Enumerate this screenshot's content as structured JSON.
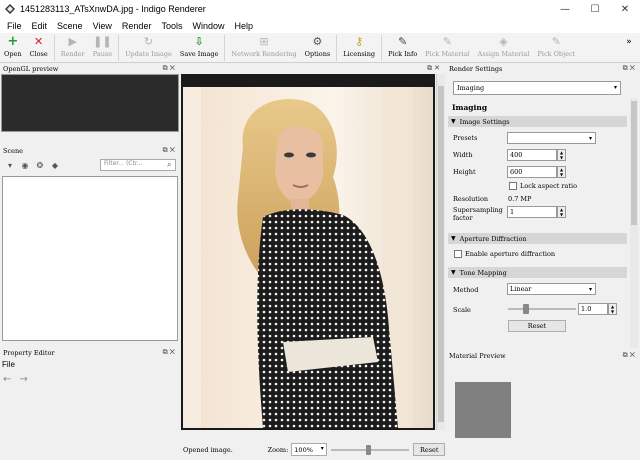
{
  "window": {
    "title": "1451283113_ATsXnwDA.jpg - Indigo Renderer"
  },
  "menu": [
    "File",
    "Edit",
    "Scene",
    "View",
    "Render",
    "Tools",
    "Window",
    "Help"
  ],
  "toolbar": {
    "open": "Open",
    "close": "Close",
    "render": "Render",
    "pause": "Pause",
    "update_image": "Update Image",
    "save_image": "Save Image",
    "network_rendering": "Network Rendering",
    "options": "Options",
    "licensing": "Licensing",
    "pick_info": "Pick Info",
    "pick_material": "Pick Material",
    "assign_material": "Assign Material",
    "pick_object": "Pick Object"
  },
  "opengl_panel": {
    "title": "OpenGL preview"
  },
  "scene_panel": {
    "title": "Scene",
    "filter_placeholder": "Filter... (Ctr..."
  },
  "property_panel": {
    "title": "Property Editor",
    "file_label": "File"
  },
  "status": {
    "text": "Opened image.",
    "zoom_label": "Zoom:",
    "zoom_value": "100%",
    "reset": "Reset",
    "zoom_slider_fraction": 0.48
  },
  "render_settings": {
    "title": "Render Settings",
    "mode": "Imaging",
    "heading": "Imaging",
    "image_settings": {
      "title": "Image Settings",
      "presets_label": "Presets",
      "presets_value": "",
      "width_label": "Width",
      "width": "400",
      "height_label": "Height",
      "height": "600",
      "lock_aspect": "Lock aspect ratio",
      "lock_aspect_checked": false,
      "resolution_label": "Resolution",
      "resolution": "0.7 MP",
      "supersampling_label_1": "Supersampling",
      "supersampling_label_2": "factor",
      "supersampling": "1"
    },
    "aperture": {
      "title": "Aperture Diffraction",
      "enable_label": "Enable aperture diffraction",
      "enabled": false
    },
    "tone_mapping": {
      "title": "Tone Mapping",
      "method_label": "Method",
      "method": "Linear",
      "scale_label": "Scale",
      "scale": "1.0",
      "reset": "Reset"
    }
  },
  "material_preview": {
    "title": "Material Preview"
  }
}
